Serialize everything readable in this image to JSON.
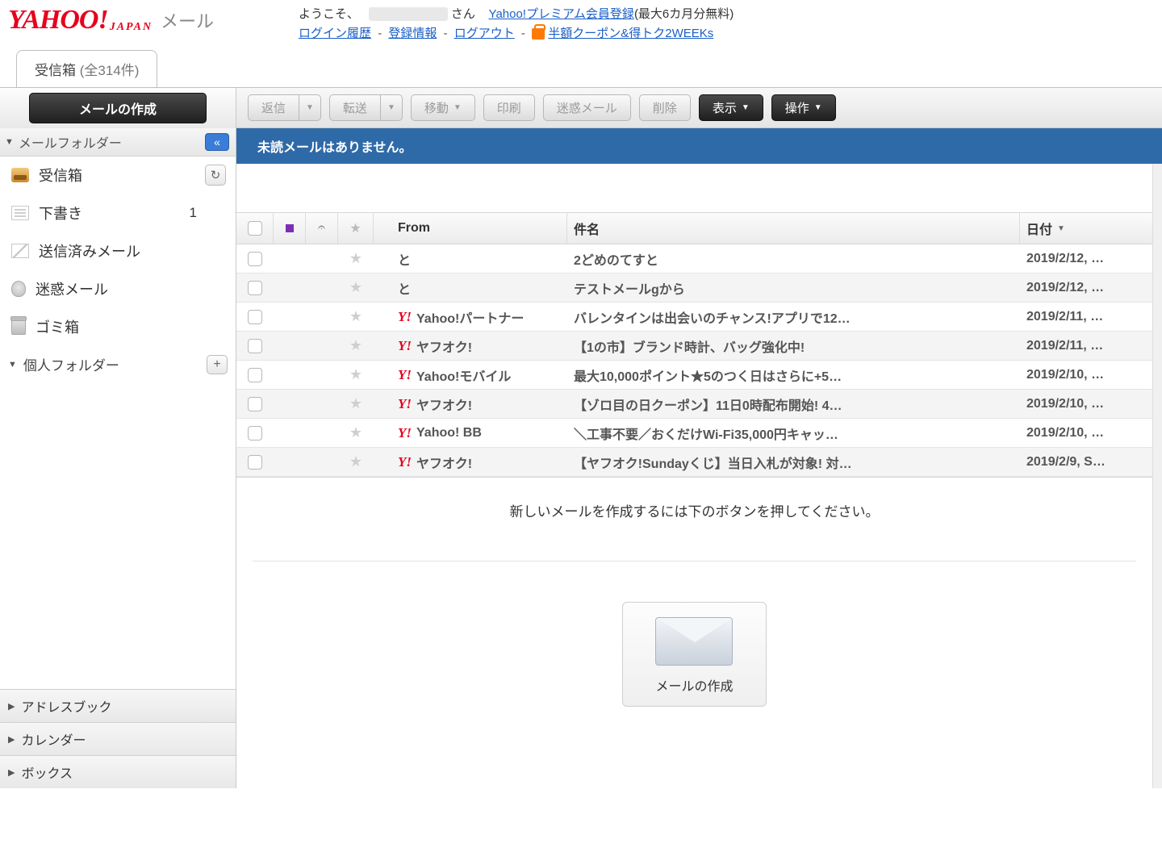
{
  "header": {
    "brand_mail": "メール",
    "greeting_prefix": "ようこそ、",
    "greeting_suffix": "さん",
    "premium_link": "Yahoo!プレミアム会員登録",
    "premium_note": "(最大6カ月分無料)",
    "links": {
      "login_history": "ログイン履歴",
      "reg_info": "登録情報",
      "logout": "ログアウト",
      "campaign": "半額クーポン&得トク2WEEKs"
    }
  },
  "tab": {
    "label": "受信箱",
    "count": "(全314件)"
  },
  "toolbar": {
    "compose": "メールの作成",
    "reply": "返信",
    "forward": "転送",
    "move": "移動",
    "print": "印刷",
    "spam": "迷惑メール",
    "delete": "削除",
    "view": "表示",
    "actions": "操作"
  },
  "side": {
    "folders_title": "メールフォルダー",
    "inbox": "受信箱",
    "drafts": "下書き",
    "drafts_count": "1",
    "sent": "送信済みメール",
    "spam": "迷惑メール",
    "trash": "ゴミ箱",
    "personal": "個人フォルダー",
    "bottom": {
      "address": "アドレスブック",
      "calendar": "カレンダー",
      "box": "ボックス"
    }
  },
  "info_bar": "未読メールはありません。",
  "columns": {
    "from": "From",
    "subject": "件名",
    "date": "日付"
  },
  "rows": [
    {
      "y": false,
      "from": "と",
      "subject": "2どめのてすと",
      "date": "2019/2/12, …"
    },
    {
      "y": false,
      "from": "と",
      "subject": "テストメールgから",
      "date": "2019/2/12, …"
    },
    {
      "y": true,
      "from": "Yahoo!パートナー",
      "subject": "バレンタインは出会いのチャンス!アプリで12…",
      "date": "2019/2/11, …"
    },
    {
      "y": true,
      "from": "ヤフオク!",
      "subject": "【1の市】ブランド時計、バッグ強化中!",
      "date": "2019/2/11, …"
    },
    {
      "y": true,
      "from": "Yahoo!モバイル",
      "subject": "最大10,000ポイント★5のつく日はさらに+5…",
      "date": "2019/2/10, …"
    },
    {
      "y": true,
      "from": "ヤフオク!",
      "subject": "【ゾロ目の日クーポン】11日0時配布開始! 4…",
      "date": "2019/2/10, …"
    },
    {
      "y": true,
      "from": "Yahoo! BB",
      "subject": "＼工事不要／おくだけWi-Fi35,000円キャッ…",
      "date": "2019/2/10, …"
    },
    {
      "y": true,
      "from": "ヤフオク!",
      "subject": "【ヤフオク!Sundayくじ】当日入札が対象! 対…",
      "date": "2019/2/9, S…"
    }
  ],
  "preview": {
    "hint": "新しいメールを作成するには下のボタンを押してください。",
    "compose": "メールの作成"
  }
}
